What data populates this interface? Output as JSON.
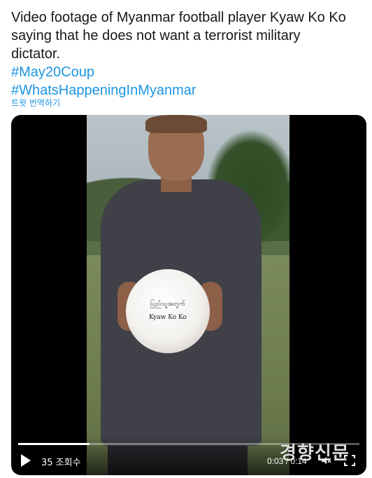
{
  "tweet": {
    "text_lines": [
      "Video footage of Myanmar football player Kyaw Ko Ko",
      "saying that he does not want a terrorist military",
      "dictator."
    ],
    "hashtags": [
      "#May20Coup",
      "#WhatsHappeningInMyanmar"
    ],
    "translate_label": "트윗 번역하기"
  },
  "video": {
    "ball_text_1": "ပြည်သူ့အတွက်",
    "ball_text_2": "Kyaw Ko Ko",
    "views": "35 조회수",
    "time": "0:03 / 0:14",
    "progress": 0.21,
    "watermark": "경향신문"
  }
}
